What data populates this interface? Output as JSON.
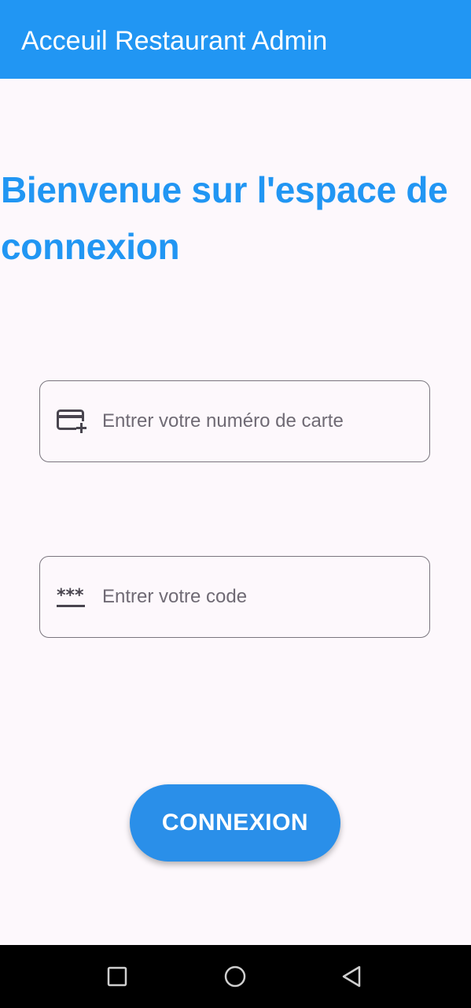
{
  "app_bar": {
    "title": "Acceuil Restaurant Admin",
    "color": "#2196f3"
  },
  "welcome": {
    "text": "Bienvenue sur l'espace de connexion"
  },
  "card_field": {
    "icon": "credit-card-add-icon",
    "placeholder": "Entrer votre numéro de carte",
    "value": ""
  },
  "code_field": {
    "icon": "password-icon",
    "placeholder": "Entrer votre code",
    "value": ""
  },
  "connect_button": {
    "label": "CONNEXION",
    "color": "#2a8fe9"
  },
  "nav_bar": {
    "recents_icon": "square-icon",
    "home_icon": "circle-icon",
    "back_icon": "triangle-back-icon"
  }
}
